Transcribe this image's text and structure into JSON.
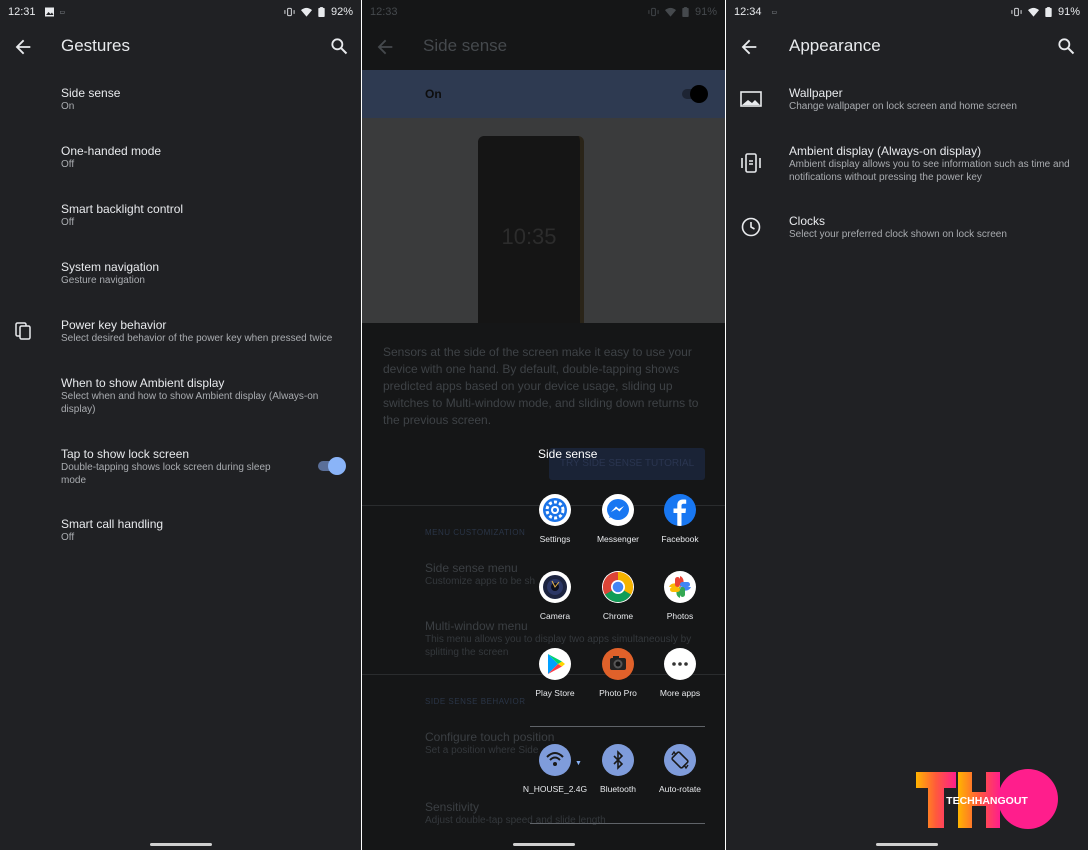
{
  "panel1": {
    "status": {
      "time": "12:31",
      "battery": "92%"
    },
    "title": "Gestures",
    "items": [
      {
        "title": "Side sense",
        "sub": "On"
      },
      {
        "title": "One-handed mode",
        "sub": "Off"
      },
      {
        "title": "Smart backlight control",
        "sub": "Off"
      },
      {
        "title": "System navigation",
        "sub": "Gesture navigation"
      },
      {
        "title": "Power key behavior",
        "sub": "Select desired behavior of the power key when pressed twice"
      },
      {
        "title": "When to show Ambient display",
        "sub": "Select when and how to show Ambient display (Always-on display)"
      },
      {
        "title": "Tap to show lock screen",
        "sub": "Double-tapping shows lock screen during sleep mode",
        "toggle": true
      },
      {
        "title": "Smart call handling",
        "sub": "Off"
      }
    ]
  },
  "panel2": {
    "status": {
      "time": "12:33",
      "battery": "91%"
    },
    "title": "Side sense",
    "switch_label": "On",
    "device_clock": "10:35",
    "description": "Sensors at the side of the screen make it easy to use your device with one hand. By default, double-tapping shows predicted apps based on your device usage, sliding up switches to Multi-window mode, and sliding down returns to the previous screen.",
    "tutorial_button": "TRY SIDE SENSE TUTORIAL",
    "section_menu": "MENU CUSTOMIZATION",
    "menu_items": [
      {
        "title": "Side sense menu",
        "sub": "Customize apps to be sh"
      },
      {
        "title": "Multi-window menu",
        "sub": "This menu allows you to display two apps simultaneously by splitting the screen"
      }
    ],
    "section_behavior": "SIDE SENSE BEHAVIOR",
    "behavior_items": [
      {
        "title": "Configure touch position",
        "sub": "Set a position where Side"
      },
      {
        "title": "Sensitivity",
        "sub": "Adjust double-tap speed and slide length"
      }
    ],
    "side_sense_label": "Side sense",
    "apps": [
      "Settings",
      "Messenger",
      "Facebook",
      "Camera",
      "Chrome",
      "Photos",
      "Play Store",
      "Photo Pro",
      "More apps"
    ],
    "quick_settings": [
      "N_HOUSE_2.4G",
      "Bluetooth",
      "Auto-rotate"
    ]
  },
  "panel3": {
    "status": {
      "time": "12:34",
      "battery": "91%"
    },
    "title": "Appearance",
    "items": [
      {
        "title": "Wallpaper",
        "sub": "Change wallpaper on lock screen and home screen",
        "icon": "wallpaper-icon"
      },
      {
        "title": "Ambient display (Always-on display)",
        "sub": "Ambient display allows you to see information such as time and notifications without pressing the power key",
        "icon": "ambient-display-icon"
      },
      {
        "title": "Clocks",
        "sub": "Select your preferred clock shown on lock screen",
        "icon": "clock-icon"
      }
    ]
  },
  "watermark": {
    "text": "TECHHANGOUT"
  },
  "colors": {
    "toggle_on": "#8ab4f8",
    "quick_tile": "#7f9cdb",
    "background": "#202124"
  }
}
